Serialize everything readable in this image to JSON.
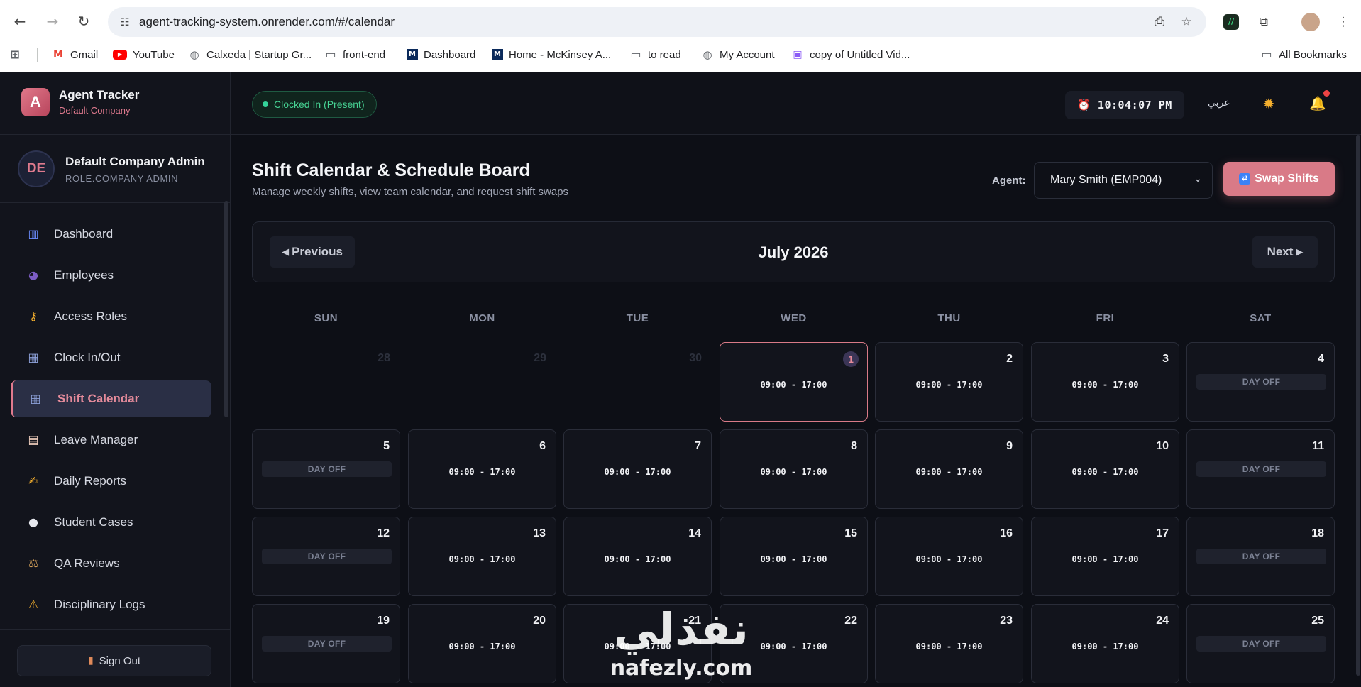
{
  "browser": {
    "url": "agent-tracking-system.onrender.com/#/calendar",
    "bookmarks": [
      {
        "label": "Gmail",
        "icon": "gmail-icon"
      },
      {
        "label": "YouTube",
        "icon": "youtube-icon"
      },
      {
        "label": "Calxeda | Startup Gr...",
        "icon": "globe-icon"
      },
      {
        "label": "front-end",
        "icon": "folder-icon"
      },
      {
        "label": "Dashboard",
        "icon": "mckinsey-icon"
      },
      {
        "label": "Home - McKinsey A...",
        "icon": "mckinsey-icon"
      },
      {
        "label": "to read",
        "icon": "folder-icon"
      },
      {
        "label": "My Account",
        "icon": "globe-icon"
      },
      {
        "label": "copy of Untitled Vid...",
        "icon": "video-icon"
      }
    ],
    "all_bookmarks": "All Bookmarks"
  },
  "brand": {
    "logo": "A",
    "name": "Agent Tracker",
    "company": "Default Company"
  },
  "user": {
    "initials": "DE",
    "name": "Default Company Admin",
    "role": "ROLE.COMPANY ADMIN"
  },
  "nav": [
    {
      "label": "Dashboard",
      "icon": "chart-icon"
    },
    {
      "label": "Employees",
      "icon": "users-icon"
    },
    {
      "label": "Access Roles",
      "icon": "key-icon"
    },
    {
      "label": "Clock In/Out",
      "icon": "calendar-icon"
    },
    {
      "label": "Shift Calendar",
      "icon": "calendar-icon"
    },
    {
      "label": "Leave Manager",
      "icon": "document-icon"
    },
    {
      "label": "Daily Reports",
      "icon": "writing-icon"
    },
    {
      "label": "Student Cases",
      "icon": "speech-bubble-icon"
    },
    {
      "label": "QA Reviews",
      "icon": "scales-icon"
    },
    {
      "label": "Disciplinary Logs",
      "icon": "warning-icon"
    }
  ],
  "signout": "Sign Out",
  "topbar": {
    "status": "Clocked In (Present)",
    "time": "10:04:07 PM",
    "language": "عربي"
  },
  "page": {
    "title": "Shift Calendar & Schedule Board",
    "subtitle": "Manage weekly shifts, view team calendar, and request shift swaps",
    "agent_label": "Agent:",
    "agent_value": "Mary Smith (EMP004)",
    "swap_label": "Swap Shifts"
  },
  "calendar": {
    "prev": "Previous",
    "next": "Next",
    "month": "July 2026",
    "weekdays": [
      "SUN",
      "MON",
      "TUE",
      "WED",
      "THU",
      "FRI",
      "SAT"
    ],
    "days": [
      {
        "n": "28",
        "other": true
      },
      {
        "n": "29",
        "other": true
      },
      {
        "n": "30",
        "other": true
      },
      {
        "n": "1",
        "today": true,
        "shift": "09:00 - 17:00"
      },
      {
        "n": "2",
        "shift": "09:00 - 17:00"
      },
      {
        "n": "3",
        "shift": "09:00 - 17:00"
      },
      {
        "n": "4",
        "off": "DAY OFF"
      },
      {
        "n": "5",
        "off": "DAY OFF"
      },
      {
        "n": "6",
        "shift": "09:00 - 17:00"
      },
      {
        "n": "7",
        "shift": "09:00 - 17:00"
      },
      {
        "n": "8",
        "shift": "09:00 - 17:00"
      },
      {
        "n": "9",
        "shift": "09:00 - 17:00"
      },
      {
        "n": "10",
        "shift": "09:00 - 17:00"
      },
      {
        "n": "11",
        "off": "DAY OFF"
      },
      {
        "n": "12",
        "off": "DAY OFF"
      },
      {
        "n": "13",
        "shift": "09:00 - 17:00"
      },
      {
        "n": "14",
        "shift": "09:00 - 17:00"
      },
      {
        "n": "15",
        "shift": "09:00 - 17:00"
      },
      {
        "n": "16",
        "shift": "09:00 - 17:00"
      },
      {
        "n": "17",
        "shift": "09:00 - 17:00"
      },
      {
        "n": "18",
        "off": "DAY OFF"
      },
      {
        "n": "19",
        "off": "DAY OFF"
      },
      {
        "n": "20",
        "shift": "09:00 - 17:00"
      },
      {
        "n": "21",
        "shift": "09:00 - 17:00"
      },
      {
        "n": "22",
        "shift": "09:00 - 17:00"
      },
      {
        "n": "23",
        "shift": "09:00 - 17:00"
      },
      {
        "n": "24",
        "shift": "09:00 - 17:00"
      },
      {
        "n": "25",
        "off": "DAY OFF"
      }
    ]
  },
  "watermark": {
    "arabic": "نفذلي",
    "latin": "nafezly.com"
  }
}
